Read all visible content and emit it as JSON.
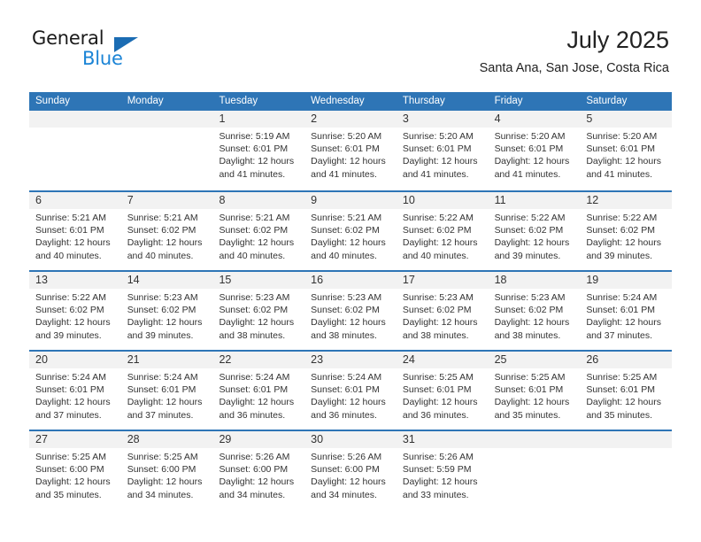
{
  "brand": {
    "name_part1": "General",
    "name_part2": "Blue",
    "triangle_icon": "triangle-logo-icon",
    "color_dark": "#1b6cb3",
    "color_light": "#1b84d6"
  },
  "header": {
    "title": "July 2025",
    "subtitle": "Santa Ana, San Jose, Costa Rica"
  },
  "theme": {
    "header_blue": "#2e75b6",
    "day_strip_gray": "#f2f2f2",
    "text_dark": "#333333"
  },
  "weekdays": [
    "Sunday",
    "Monday",
    "Tuesday",
    "Wednesday",
    "Thursday",
    "Friday",
    "Saturday"
  ],
  "weeks": [
    [
      {
        "day": "",
        "empty": true,
        "lines": []
      },
      {
        "day": "",
        "empty": true,
        "lines": []
      },
      {
        "day": "1",
        "empty": false,
        "lines": [
          "Sunrise: 5:19 AM",
          "Sunset: 6:01 PM",
          "Daylight: 12 hours",
          "and 41 minutes."
        ]
      },
      {
        "day": "2",
        "empty": false,
        "lines": [
          "Sunrise: 5:20 AM",
          "Sunset: 6:01 PM",
          "Daylight: 12 hours",
          "and 41 minutes."
        ]
      },
      {
        "day": "3",
        "empty": false,
        "lines": [
          "Sunrise: 5:20 AM",
          "Sunset: 6:01 PM",
          "Daylight: 12 hours",
          "and 41 minutes."
        ]
      },
      {
        "day": "4",
        "empty": false,
        "lines": [
          "Sunrise: 5:20 AM",
          "Sunset: 6:01 PM",
          "Daylight: 12 hours",
          "and 41 minutes."
        ]
      },
      {
        "day": "5",
        "empty": false,
        "lines": [
          "Sunrise: 5:20 AM",
          "Sunset: 6:01 PM",
          "Daylight: 12 hours",
          "and 41 minutes."
        ]
      }
    ],
    [
      {
        "day": "6",
        "empty": false,
        "lines": [
          "Sunrise: 5:21 AM",
          "Sunset: 6:01 PM",
          "Daylight: 12 hours",
          "and 40 minutes."
        ]
      },
      {
        "day": "7",
        "empty": false,
        "lines": [
          "Sunrise: 5:21 AM",
          "Sunset: 6:02 PM",
          "Daylight: 12 hours",
          "and 40 minutes."
        ]
      },
      {
        "day": "8",
        "empty": false,
        "lines": [
          "Sunrise: 5:21 AM",
          "Sunset: 6:02 PM",
          "Daylight: 12 hours",
          "and 40 minutes."
        ]
      },
      {
        "day": "9",
        "empty": false,
        "lines": [
          "Sunrise: 5:21 AM",
          "Sunset: 6:02 PM",
          "Daylight: 12 hours",
          "and 40 minutes."
        ]
      },
      {
        "day": "10",
        "empty": false,
        "lines": [
          "Sunrise: 5:22 AM",
          "Sunset: 6:02 PM",
          "Daylight: 12 hours",
          "and 40 minutes."
        ]
      },
      {
        "day": "11",
        "empty": false,
        "lines": [
          "Sunrise: 5:22 AM",
          "Sunset: 6:02 PM",
          "Daylight: 12 hours",
          "and 39 minutes."
        ]
      },
      {
        "day": "12",
        "empty": false,
        "lines": [
          "Sunrise: 5:22 AM",
          "Sunset: 6:02 PM",
          "Daylight: 12 hours",
          "and 39 minutes."
        ]
      }
    ],
    [
      {
        "day": "13",
        "empty": false,
        "lines": [
          "Sunrise: 5:22 AM",
          "Sunset: 6:02 PM",
          "Daylight: 12 hours",
          "and 39 minutes."
        ]
      },
      {
        "day": "14",
        "empty": false,
        "lines": [
          "Sunrise: 5:23 AM",
          "Sunset: 6:02 PM",
          "Daylight: 12 hours",
          "and 39 minutes."
        ]
      },
      {
        "day": "15",
        "empty": false,
        "lines": [
          "Sunrise: 5:23 AM",
          "Sunset: 6:02 PM",
          "Daylight: 12 hours",
          "and 38 minutes."
        ]
      },
      {
        "day": "16",
        "empty": false,
        "lines": [
          "Sunrise: 5:23 AM",
          "Sunset: 6:02 PM",
          "Daylight: 12 hours",
          "and 38 minutes."
        ]
      },
      {
        "day": "17",
        "empty": false,
        "lines": [
          "Sunrise: 5:23 AM",
          "Sunset: 6:02 PM",
          "Daylight: 12 hours",
          "and 38 minutes."
        ]
      },
      {
        "day": "18",
        "empty": false,
        "lines": [
          "Sunrise: 5:23 AM",
          "Sunset: 6:02 PM",
          "Daylight: 12 hours",
          "and 38 minutes."
        ]
      },
      {
        "day": "19",
        "empty": false,
        "lines": [
          "Sunrise: 5:24 AM",
          "Sunset: 6:01 PM",
          "Daylight: 12 hours",
          "and 37 minutes."
        ]
      }
    ],
    [
      {
        "day": "20",
        "empty": false,
        "lines": [
          "Sunrise: 5:24 AM",
          "Sunset: 6:01 PM",
          "Daylight: 12 hours",
          "and 37 minutes."
        ]
      },
      {
        "day": "21",
        "empty": false,
        "lines": [
          "Sunrise: 5:24 AM",
          "Sunset: 6:01 PM",
          "Daylight: 12 hours",
          "and 37 minutes."
        ]
      },
      {
        "day": "22",
        "empty": false,
        "lines": [
          "Sunrise: 5:24 AM",
          "Sunset: 6:01 PM",
          "Daylight: 12 hours",
          "and 36 minutes."
        ]
      },
      {
        "day": "23",
        "empty": false,
        "lines": [
          "Sunrise: 5:24 AM",
          "Sunset: 6:01 PM",
          "Daylight: 12 hours",
          "and 36 minutes."
        ]
      },
      {
        "day": "24",
        "empty": false,
        "lines": [
          "Sunrise: 5:25 AM",
          "Sunset: 6:01 PM",
          "Daylight: 12 hours",
          "and 36 minutes."
        ]
      },
      {
        "day": "25",
        "empty": false,
        "lines": [
          "Sunrise: 5:25 AM",
          "Sunset: 6:01 PM",
          "Daylight: 12 hours",
          "and 35 minutes."
        ]
      },
      {
        "day": "26",
        "empty": false,
        "lines": [
          "Sunrise: 5:25 AM",
          "Sunset: 6:01 PM",
          "Daylight: 12 hours",
          "and 35 minutes."
        ]
      }
    ],
    [
      {
        "day": "27",
        "empty": false,
        "lines": [
          "Sunrise: 5:25 AM",
          "Sunset: 6:00 PM",
          "Daylight: 12 hours",
          "and 35 minutes."
        ]
      },
      {
        "day": "28",
        "empty": false,
        "lines": [
          "Sunrise: 5:25 AM",
          "Sunset: 6:00 PM",
          "Daylight: 12 hours",
          "and 34 minutes."
        ]
      },
      {
        "day": "29",
        "empty": false,
        "lines": [
          "Sunrise: 5:26 AM",
          "Sunset: 6:00 PM",
          "Daylight: 12 hours",
          "and 34 minutes."
        ]
      },
      {
        "day": "30",
        "empty": false,
        "lines": [
          "Sunrise: 5:26 AM",
          "Sunset: 6:00 PM",
          "Daylight: 12 hours",
          "and 34 minutes."
        ]
      },
      {
        "day": "31",
        "empty": false,
        "lines": [
          "Sunrise: 5:26 AM",
          "Sunset: 5:59 PM",
          "Daylight: 12 hours",
          "and 33 minutes."
        ]
      },
      {
        "day": "",
        "empty": true,
        "lines": []
      },
      {
        "day": "",
        "empty": true,
        "lines": []
      }
    ]
  ]
}
